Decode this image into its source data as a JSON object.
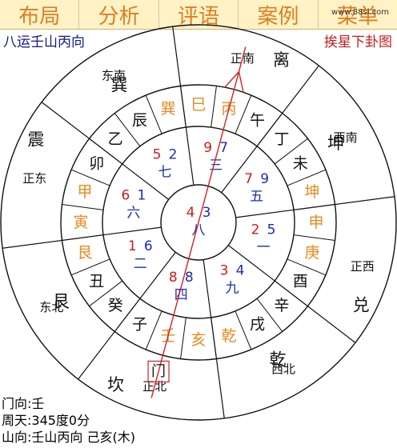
{
  "tabs": [
    "布局",
    "分析",
    "评语",
    "案例",
    "菜单"
  ],
  "watermark": "www.88sl.com",
  "chart_title": "八运壬山丙向",
  "method_link": "挨星下卦图",
  "directions": [
    "正南",
    "西南",
    "正西",
    "西北",
    "正北",
    "东北",
    "正东",
    "东南"
  ],
  "trigrams": [
    "离",
    "坤",
    "兑",
    "乾",
    "坎",
    "艮",
    "震",
    "巽"
  ],
  "mountains": [
    {
      "label": "丙",
      "color": "orange"
    },
    {
      "label": "午",
      "color": "black"
    },
    {
      "label": "丁",
      "color": "black"
    },
    {
      "label": "未",
      "color": "black"
    },
    {
      "label": "坤",
      "color": "orange"
    },
    {
      "label": "申",
      "color": "orange"
    },
    {
      "label": "庚",
      "color": "orange"
    },
    {
      "label": "酉",
      "color": "black"
    },
    {
      "label": "辛",
      "color": "black"
    },
    {
      "label": "戌",
      "color": "black"
    },
    {
      "label": "乾",
      "color": "orange"
    },
    {
      "label": "亥",
      "color": "orange"
    },
    {
      "label": "壬",
      "color": "orange"
    },
    {
      "label": "子",
      "color": "black"
    },
    {
      "label": "癸",
      "color": "black"
    },
    {
      "label": "丑",
      "color": "black"
    },
    {
      "label": "艮",
      "color": "orange"
    },
    {
      "label": "寅",
      "color": "orange"
    },
    {
      "label": "甲",
      "color": "orange"
    },
    {
      "label": "卯",
      "color": "black"
    },
    {
      "label": "乙",
      "color": "black"
    },
    {
      "label": "辰",
      "color": "black"
    },
    {
      "label": "巽",
      "color": "orange"
    },
    {
      "label": "巳",
      "color": "orange"
    }
  ],
  "palaces": [
    {
      "name": "center",
      "mountain_star": "4",
      "water_star": "3",
      "base": "八"
    },
    {
      "name": "south",
      "mountain_star": "9",
      "water_star": "7",
      "base": "三"
    },
    {
      "name": "southwest",
      "mountain_star": "7",
      "water_star": "9",
      "base": "五"
    },
    {
      "name": "west",
      "mountain_star": "2",
      "water_star": "5",
      "base": "一"
    },
    {
      "name": "northwest",
      "mountain_star": "3",
      "water_star": "4",
      "base": "九"
    },
    {
      "name": "north",
      "mountain_star": "8",
      "water_star": "8",
      "base": "四"
    },
    {
      "name": "northeast",
      "mountain_star": "1",
      "water_star": "6",
      "base": "二"
    },
    {
      "name": "east",
      "mountain_star": "6",
      "water_star": "1",
      "base": "六"
    },
    {
      "name": "southeast",
      "mountain_star": "5",
      "water_star": "2",
      "base": "七"
    }
  ],
  "door_label": "门",
  "colors": {
    "mountain_star": "#d11b1b",
    "water_star": "#1a2eb0",
    "base_star": "#1a2eb0",
    "orange": "#e88a1f",
    "black": "#111111",
    "needle": "#d42020"
  },
  "info": {
    "door_direction": "门向:壬",
    "degree": "周天:345度0分",
    "mountain_direction": "山向:壬山丙向 己亥(木)"
  }
}
